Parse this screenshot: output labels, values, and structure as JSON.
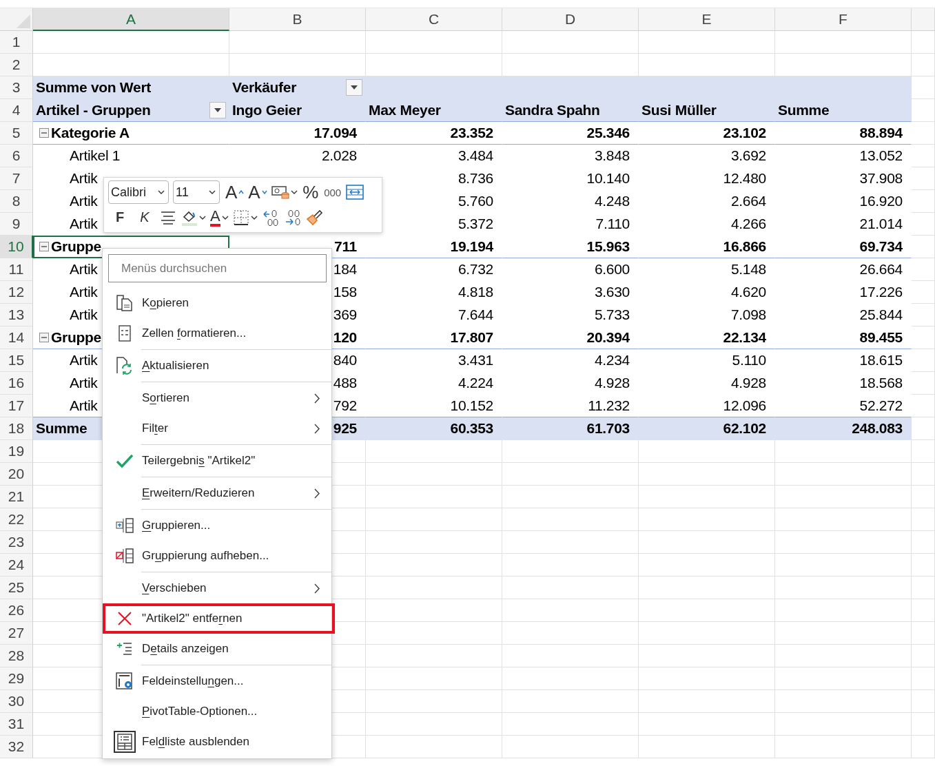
{
  "columns": [
    {
      "letter": "A",
      "selected": true
    },
    {
      "letter": "B",
      "selected": false
    },
    {
      "letter": "C",
      "selected": false
    },
    {
      "letter": "D",
      "selected": false
    },
    {
      "letter": "E",
      "selected": false
    },
    {
      "letter": "F",
      "selected": false
    }
  ],
  "rows": [
    {
      "number": "1",
      "selected": false,
      "kind": "blank"
    },
    {
      "number": "2",
      "selected": false,
      "kind": "blank"
    },
    {
      "number": "3",
      "selected": false,
      "kind": "field-header",
      "label": "Summe von Wert",
      "column_field": "Verkäufer"
    },
    {
      "number": "4",
      "selected": false,
      "kind": "column-header",
      "label": "Artikel - Gruppen",
      "values": {
        "B": "Ingo Geier",
        "C": "Max Meyer",
        "D": "Sandra Spahn",
        "E": "Susi Müller",
        "F": "Summe"
      }
    },
    {
      "number": "5",
      "selected": false,
      "kind": "group",
      "expanded": true,
      "label": "Kategorie A",
      "values": {
        "B": "17.094",
        "C": "23.352",
        "D": "25.346",
        "E": "23.102",
        "F": "88.894"
      }
    },
    {
      "number": "6",
      "selected": false,
      "kind": "item",
      "label": "Artikel 1",
      "values": {
        "B": "2.028",
        "C": "3.484",
        "D": "3.848",
        "E": "3.692",
        "F": "13.052"
      }
    },
    {
      "number": "7",
      "selected": false,
      "kind": "item",
      "label": "Artik",
      "values": {
        "C": "8.736",
        "D": "10.140",
        "E": "12.480",
        "F": "37.908"
      }
    },
    {
      "number": "8",
      "selected": false,
      "kind": "item",
      "label": "Artik",
      "values": {
        "C": "5.760",
        "D": "4.248",
        "E": "2.664",
        "F": "16.920"
      }
    },
    {
      "number": "9",
      "selected": false,
      "kind": "item",
      "label": "Artik",
      "values": {
        "C": "5.372",
        "D": "7.110",
        "E": "4.266",
        "F": "21.014"
      }
    },
    {
      "number": "10",
      "selected": true,
      "kind": "group",
      "expanded": true,
      "label": "Gruppe",
      "values": {
        "B": "711",
        "C": "19.194",
        "D": "15.963",
        "E": "16.866",
        "F": "69.734"
      }
    },
    {
      "number": "11",
      "selected": false,
      "kind": "item",
      "label": "Artik",
      "values": {
        "B": "184",
        "C": "6.732",
        "D": "6.600",
        "E": "5.148",
        "F": "26.664"
      }
    },
    {
      "number": "12",
      "selected": false,
      "kind": "item",
      "label": "Artik",
      "values": {
        "B": "158",
        "C": "4.818",
        "D": "3.630",
        "E": "4.620",
        "F": "17.226"
      }
    },
    {
      "number": "13",
      "selected": false,
      "kind": "item",
      "label": "Artik",
      "values": {
        "B": "369",
        "C": "7.644",
        "D": "5.733",
        "E": "7.098",
        "F": "25.844"
      }
    },
    {
      "number": "14",
      "selected": false,
      "kind": "group",
      "expanded": true,
      "label": "Gruppe",
      "values": {
        "B": "120",
        "C": "17.807",
        "D": "20.394",
        "E": "22.134",
        "F": "89.455"
      }
    },
    {
      "number": "15",
      "selected": false,
      "kind": "item",
      "label": "Artik",
      "values": {
        "B": "840",
        "C": "3.431",
        "D": "4.234",
        "E": "5.110",
        "F": "18.615"
      }
    },
    {
      "number": "16",
      "selected": false,
      "kind": "item",
      "label": "Artik",
      "values": {
        "B": "488",
        "C": "4.224",
        "D": "4.928",
        "E": "4.928",
        "F": "18.568"
      }
    },
    {
      "number": "17",
      "selected": false,
      "kind": "item",
      "label": "Artik",
      "values": {
        "B": "792",
        "C": "10.152",
        "D": "11.232",
        "E": "12.096",
        "F": "52.272"
      }
    },
    {
      "number": "18",
      "selected": false,
      "kind": "total",
      "label": "Summe",
      "values": {
        "B": "925",
        "C": "60.353",
        "D": "61.703",
        "E": "62.102",
        "F": "248.083"
      }
    },
    {
      "number": "19",
      "selected": false,
      "kind": "blank"
    },
    {
      "number": "20",
      "selected": false,
      "kind": "blank"
    },
    {
      "number": "21",
      "selected": false,
      "kind": "blank"
    },
    {
      "number": "22",
      "selected": false,
      "kind": "blank"
    },
    {
      "number": "23",
      "selected": false,
      "kind": "blank"
    },
    {
      "number": "24",
      "selected": false,
      "kind": "blank"
    },
    {
      "number": "25",
      "selected": false,
      "kind": "blank"
    },
    {
      "number": "26",
      "selected": false,
      "kind": "blank"
    },
    {
      "number": "27",
      "selected": false,
      "kind": "blank"
    },
    {
      "number": "28",
      "selected": false,
      "kind": "blank"
    },
    {
      "number": "29",
      "selected": false,
      "kind": "blank"
    },
    {
      "number": "30",
      "selected": false,
      "kind": "blank"
    },
    {
      "number": "31",
      "selected": false,
      "kind": "blank"
    },
    {
      "number": "32",
      "selected": false,
      "kind": "blank"
    }
  ],
  "mini_toolbar": {
    "font": "Calibri",
    "size": "11",
    "row_1": [
      {
        "kind": "grow-font",
        "label": "A"
      },
      {
        "kind": "shrink-font",
        "label": "A"
      },
      {
        "kind": "number-format",
        "dropdown": true
      },
      {
        "kind": "percent",
        "label": "%"
      },
      {
        "kind": "thousands",
        "label": "000"
      },
      {
        "kind": "wrap"
      }
    ],
    "row_2": [
      {
        "kind": "bold",
        "label": "F"
      },
      {
        "kind": "italic",
        "label": "K"
      },
      {
        "kind": "align"
      },
      {
        "kind": "fill",
        "dropdown": true
      },
      {
        "kind": "font-color",
        "label": "A",
        "dropdown": true
      },
      {
        "kind": "borders",
        "dropdown": true
      },
      {
        "kind": "increase-decimal"
      },
      {
        "kind": "decrease-decimal"
      },
      {
        "kind": "format-painter"
      }
    ]
  },
  "context_menu": {
    "search": {
      "placeholder": "Menüs durchsuchen"
    },
    "items": [
      {
        "kind": "copy",
        "label": {
          "before": "K",
          "key": "o",
          "after": "pieren"
        },
        "submenu": false,
        "checked": false,
        "highlighted": false,
        "separator_before": false
      },
      {
        "kind": "format",
        "label": {
          "before": "Zellen ",
          "key": "f",
          "after": "ormatieren..."
        },
        "submenu": false,
        "checked": false,
        "highlighted": false,
        "separator_before": false
      },
      {
        "kind": "refresh",
        "label": {
          "key": "A",
          "after": "ktualisieren"
        },
        "submenu": false,
        "checked": false,
        "highlighted": false,
        "separator_before": true
      },
      {
        "kind": "plain",
        "label": {
          "before": "S",
          "key": "o",
          "after": "rtieren"
        },
        "submenu": true,
        "checked": false,
        "highlighted": false,
        "separator_before": true
      },
      {
        "kind": "plain",
        "label": {
          "before": "Fil",
          "key": "t",
          "after": "er"
        },
        "submenu": true,
        "checked": false,
        "highlighted": false,
        "separator_before": false
      },
      {
        "kind": "plain",
        "label": {
          "before": "Teilergebni",
          "key": "s",
          "after": " \"Artikel2\""
        },
        "submenu": false,
        "checked": true,
        "highlighted": false,
        "separator_before": true
      },
      {
        "kind": "plain",
        "label": {
          "key": "E",
          "after": "rweitern/Reduzieren"
        },
        "submenu": true,
        "checked": false,
        "highlighted": false,
        "separator_before": true
      },
      {
        "kind": "group",
        "label": {
          "key": "G",
          "after": "ruppieren..."
        },
        "submenu": false,
        "checked": false,
        "highlighted": false,
        "separator_before": true
      },
      {
        "kind": "ungroup",
        "label": {
          "before": "Gr",
          "key": "u",
          "after": "ppierung aufheben..."
        },
        "submenu": false,
        "checked": false,
        "highlighted": false,
        "separator_before": false
      },
      {
        "kind": "plain",
        "label": {
          "key": "V",
          "after": "erschieben"
        },
        "submenu": true,
        "checked": false,
        "highlighted": false,
        "separator_before": true
      },
      {
        "kind": "remove",
        "label": {
          "before": "\"Artikel2\" entfe",
          "key": "r",
          "after": "nen"
        },
        "submenu": false,
        "checked": false,
        "highlighted": true,
        "separator_before": false
      },
      {
        "kind": "details",
        "label": {
          "before": "D",
          "key": "e",
          "after": "tails anzeigen"
        },
        "submenu": false,
        "checked": false,
        "highlighted": false,
        "separator_before": false
      },
      {
        "kind": "field-settings",
        "label": {
          "before": "Feldeinstellu",
          "key": "n",
          "after": "gen..."
        },
        "submenu": false,
        "checked": false,
        "highlighted": false,
        "separator_before": true
      },
      {
        "kind": "plain",
        "label": {
          "key": "P",
          "after": "ivotTable-Optionen..."
        },
        "submenu": false,
        "checked": false,
        "highlighted": false,
        "separator_before": false
      },
      {
        "kind": "field-list",
        "label": {
          "before": "Fel",
          "key": "d",
          "after": "liste ausblenden"
        },
        "submenu": false,
        "checked": false,
        "highlighted": false,
        "separator_before": false
      }
    ]
  }
}
